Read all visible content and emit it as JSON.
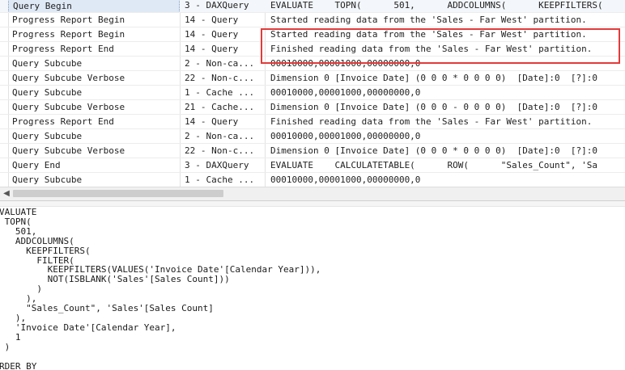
{
  "trace_rows": [
    {
      "event": "Query Begin",
      "subclass": "3 - DAXQuery",
      "text": "EVALUATE    TOPN(      501,      ADDCOLUMNS(      KEEPFILTERS(",
      "selected": true
    },
    {
      "event": "Progress Report Begin",
      "subclass": "14 - Query",
      "text": "Started reading data from the 'Sales - Far West' partition.",
      "selected": false
    },
    {
      "event": "Progress Report Begin",
      "subclass": "14 - Query",
      "text": "Started reading data from the 'Sales - Far West' partition.",
      "selected": false
    },
    {
      "event": "Progress Report End",
      "subclass": "14 - Query",
      "text": "Finished reading data from the 'Sales - Far West' partition.",
      "selected": false
    },
    {
      "event": "Query Subcube",
      "subclass": "2 - Non-ca...",
      "text": "00010000,00001000,00000000,0",
      "selected": false
    },
    {
      "event": "Query Subcube Verbose",
      "subclass": "22 - Non-c...",
      "text": "Dimension 0 [Invoice Date] (0 0 0 * 0 0 0 0)  [Date]:0  [?]:0",
      "selected": false
    },
    {
      "event": "Query Subcube",
      "subclass": "1 - Cache ...",
      "text": "00010000,00001000,00000000,0",
      "selected": false
    },
    {
      "event": "Query Subcube Verbose",
      "subclass": "21 - Cache...",
      "text": "Dimension 0 [Invoice Date] (0 0 0 - 0 0 0 0)  [Date]:0  [?]:0",
      "selected": false
    },
    {
      "event": "Progress Report End",
      "subclass": "14 - Query",
      "text": "Finished reading data from the 'Sales - Far West' partition.",
      "selected": false
    },
    {
      "event": "Query Subcube",
      "subclass": "2 - Non-ca...",
      "text": "00010000,00001000,00000000,0",
      "selected": false
    },
    {
      "event": "Query Subcube Verbose",
      "subclass": "22 - Non-c...",
      "text": "Dimension 0 [Invoice Date] (0 0 0 * 0 0 0 0)  [Date]:0  [?]:0",
      "selected": false
    },
    {
      "event": "Query End",
      "subclass": "3 - DAXQuery",
      "text": "EVALUATE    CALCULATETABLE(      ROW(      \"Sales_Count\", 'Sa",
      "selected": false
    },
    {
      "event": "Query Subcube",
      "subclass": "1 - Cache ...",
      "text": "00010000,00001000,00000000,0",
      "selected": false
    }
  ],
  "scroll_left_icon": "chevron-left-icon",
  "scroll_left_glyph": "◀",
  "query_text": "VALUATE\n TOPN(\n   501,\n   ADDCOLUMNS(\n     KEEPFILTERS(\n       FILTER(\n         KEEPFILTERS(VALUES('Invoice Date'[Calendar Year])),\n         NOT(ISBLANK('Sales'[Sales Count]))\n       )\n     ),\n     \"Sales_Count\", 'Sales'[Sales Count]\n   ),\n   'Invoice Date'[Calendar Year],\n   1\n )\n\nRDER BY\n 'Invoice Date'[Calendar Year]",
  "colors": {
    "highlight_border": "#e23b3b",
    "selection": "#dfe9f6"
  }
}
